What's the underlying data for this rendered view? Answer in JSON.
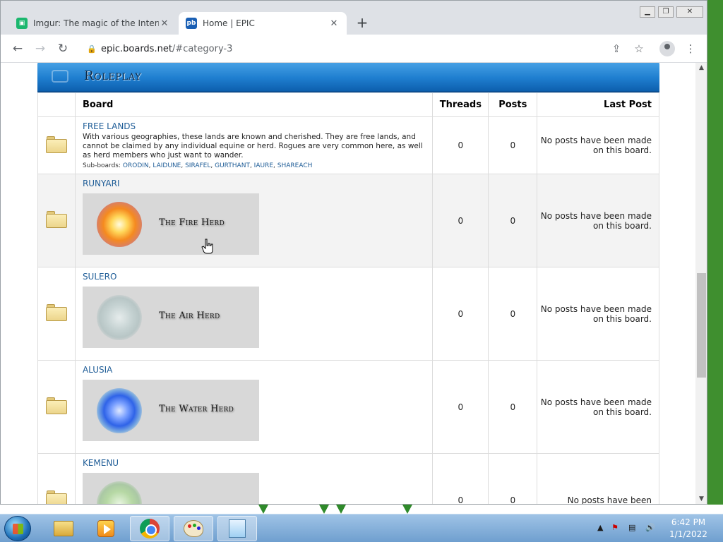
{
  "browser": {
    "tabs": [
      {
        "title": "Imgur: The magic of the Internet",
        "favicon": "imgur-icon"
      },
      {
        "title": "Home | EPIC",
        "favicon": "proboards-icon"
      }
    ],
    "new_tab_label": "+",
    "url_host": "epic.boards.net",
    "url_path": "/#category-3"
  },
  "category": {
    "title": "Roleplay",
    "columns": {
      "board": "Board",
      "threads": "Threads",
      "posts": "Posts",
      "last_post": "Last Post"
    },
    "boards": [
      {
        "name": "FREE LANDS",
        "description": "With various geographies, these lands are known and cherished. They are free lands, and cannot be claimed by any individual equine or herd. Rogues are very common here, as well as herd members who just want to wander.",
        "subboards_label": "Sub-boards:",
        "subboards": [
          "ORODIN",
          "LAIDUNE",
          "SIRAFEL",
          "GURTHANT",
          "IAURE",
          "SHAREACH"
        ],
        "threads": "0",
        "posts": "0",
        "last_post": "No posts have been made on this board."
      },
      {
        "name": "RUNYARI",
        "banner_text": "The Fire Herd",
        "threads": "0",
        "posts": "0",
        "last_post": "No posts have been made on this board."
      },
      {
        "name": "SULERO",
        "banner_text": "The Air Herd",
        "threads": "0",
        "posts": "0",
        "last_post": "No posts have been made on this board."
      },
      {
        "name": "ALUSIA",
        "banner_text": "The Water Herd",
        "threads": "0",
        "posts": "0",
        "last_post": "No posts have been made on this board."
      },
      {
        "name": "KEMENU",
        "threads": "0",
        "posts": "0",
        "last_post": "No posts have been"
      }
    ]
  },
  "taskbar": {
    "time": "6:42 PM",
    "date": "1/1/2022"
  },
  "colors": {
    "category_header": "#1f7fd0",
    "board_link": "#1f5d97"
  }
}
